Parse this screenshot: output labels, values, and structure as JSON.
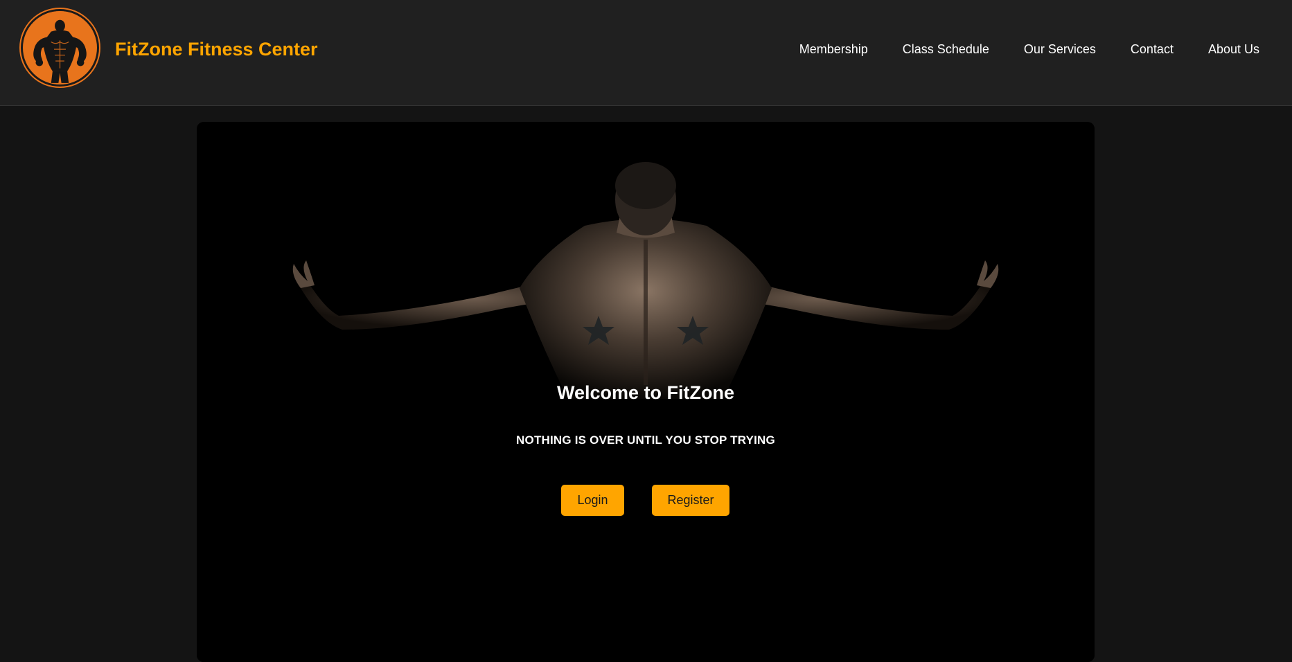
{
  "brand": {
    "name": "FitZone Fitness Center",
    "logo_icon": "bodybuilder-logo-icon",
    "color": "#ffa500"
  },
  "nav": {
    "items": [
      {
        "label": "Membership"
      },
      {
        "label": "Class Schedule"
      },
      {
        "label": "Our Services"
      },
      {
        "label": "Contact"
      },
      {
        "label": "About Us"
      }
    ]
  },
  "hero": {
    "title": "Welcome to FitZone",
    "tagline": "NOTHING IS OVER UNTIL YOU STOP TRYING",
    "login_label": "Login",
    "register_label": "Register",
    "accent": "#ffa500"
  }
}
